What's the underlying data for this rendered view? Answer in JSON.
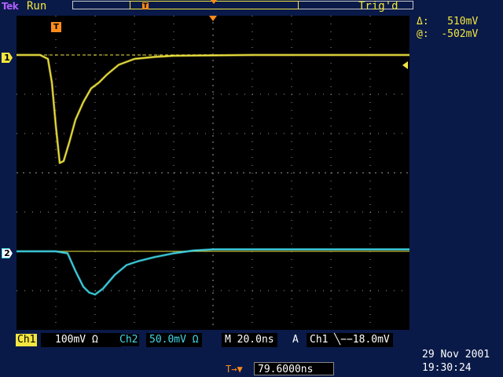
{
  "topbar": {
    "brand": "Tek",
    "run_state": "Run",
    "trigger_state": "Trig'd"
  },
  "readout": {
    "delta_label": "Δ:",
    "delta_value": "510mV",
    "at_label": "@:",
    "at_value": "-502mV"
  },
  "markers": {
    "ch1": "1",
    "ch2": "2",
    "trigger_position": "T"
  },
  "status": {
    "ch1_label": "Ch1",
    "ch1_scale": "100mV Ω",
    "ch2_label": "Ch2",
    "ch2_scale": "50.0mV Ω",
    "timebase": "M 20.0ns",
    "acq_mode": "A",
    "trigger": "Ch1 ╲−−18.0mV"
  },
  "horizontal_position": {
    "icon": "T→▼",
    "value": "79.6000ns"
  },
  "clock": {
    "date": "29 Nov 2001",
    "time": "19:30:24"
  },
  "colors": {
    "background": "#0a1a48",
    "ch1": "#f2e640",
    "ch2": "#40d8e8",
    "trigger": "#ff8c1a"
  },
  "chart_data": {
    "type": "line",
    "grid": true,
    "x_divisions": 10,
    "y_divisions": 8,
    "series": [
      {
        "name": "Ch1",
        "color": "#f2e640",
        "x_div": [
          0,
          0.6,
          0.8,
          0.9,
          1.0,
          1.1,
          1.2,
          1.35,
          1.5,
          1.7,
          1.9,
          2.1,
          2.3,
          2.6,
          3.0,
          3.5,
          4.0,
          5.0,
          6.0,
          8.0,
          10.0
        ],
        "y_div": [
          3.0,
          3.0,
          2.9,
          2.3,
          1.2,
          0.25,
          0.3,
          0.8,
          1.35,
          1.8,
          2.15,
          2.3,
          2.5,
          2.75,
          2.9,
          2.95,
          2.98,
          2.99,
          3.0,
          3.0,
          3.0
        ]
      },
      {
        "name": "Ch2",
        "color": "#40d8e8",
        "x_div": [
          0,
          1.0,
          1.3,
          1.5,
          1.7,
          1.85,
          2.0,
          2.2,
          2.5,
          2.8,
          3.1,
          3.5,
          4.0,
          4.5,
          5.0,
          6.0,
          8.0,
          10.0
        ],
        "y_div": [
          -2.0,
          -2.0,
          -2.05,
          -2.5,
          -2.9,
          -3.05,
          -3.1,
          -2.95,
          -2.6,
          -2.35,
          -2.25,
          -2.15,
          -2.05,
          -1.98,
          -1.95,
          -1.95,
          -1.95,
          -1.95
        ]
      }
    ],
    "reference_levels": [
      {
        "name": "ch1-ground",
        "y_div": 3.0,
        "color": "#f2e640",
        "dashed": true
      },
      {
        "name": "ch2-ground",
        "y_div": -2.0,
        "color": "#f2e640",
        "dashed": false
      }
    ]
  }
}
